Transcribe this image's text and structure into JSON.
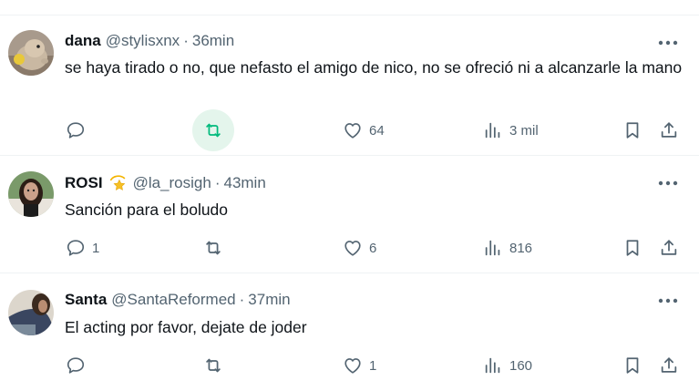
{
  "tweets": [
    {
      "name": "dana",
      "handle": "@stylisxnx",
      "separator": "·",
      "time": "36min",
      "text": "se haya tirado o no, que nefasto el amigo de nico, no se ofreció ni a alcanzarle la mano",
      "replies": "",
      "retweets": "",
      "likes": "64",
      "views": "3 mil",
      "retweet_active": true,
      "avatar_icon": "hamster-photo"
    },
    {
      "name": "ROSI",
      "badge_icon": "dizzy-star-emoji",
      "handle": "@la_rosigh",
      "separator": "·",
      "time": "43min",
      "text": "Sanción para el boludo",
      "replies": "1",
      "retweets": "",
      "likes": "6",
      "views": "816",
      "retweet_active": false,
      "avatar_icon": "woman-photo"
    },
    {
      "name": "Santa",
      "handle": "@SantaReformed",
      "separator": "·",
      "time": "37min",
      "text": "El acting por favor, dejate de joder",
      "replies": "",
      "retweets": "",
      "likes": "1",
      "views": "160",
      "retweet_active": false,
      "avatar_icon": "person-photo"
    }
  ],
  "colors": {
    "text": "#0f1419",
    "secondary": "#536471",
    "retweet_active": "#00ba7c",
    "retweet_highlight": "#e4f5ec",
    "divider": "#eff3f4"
  }
}
